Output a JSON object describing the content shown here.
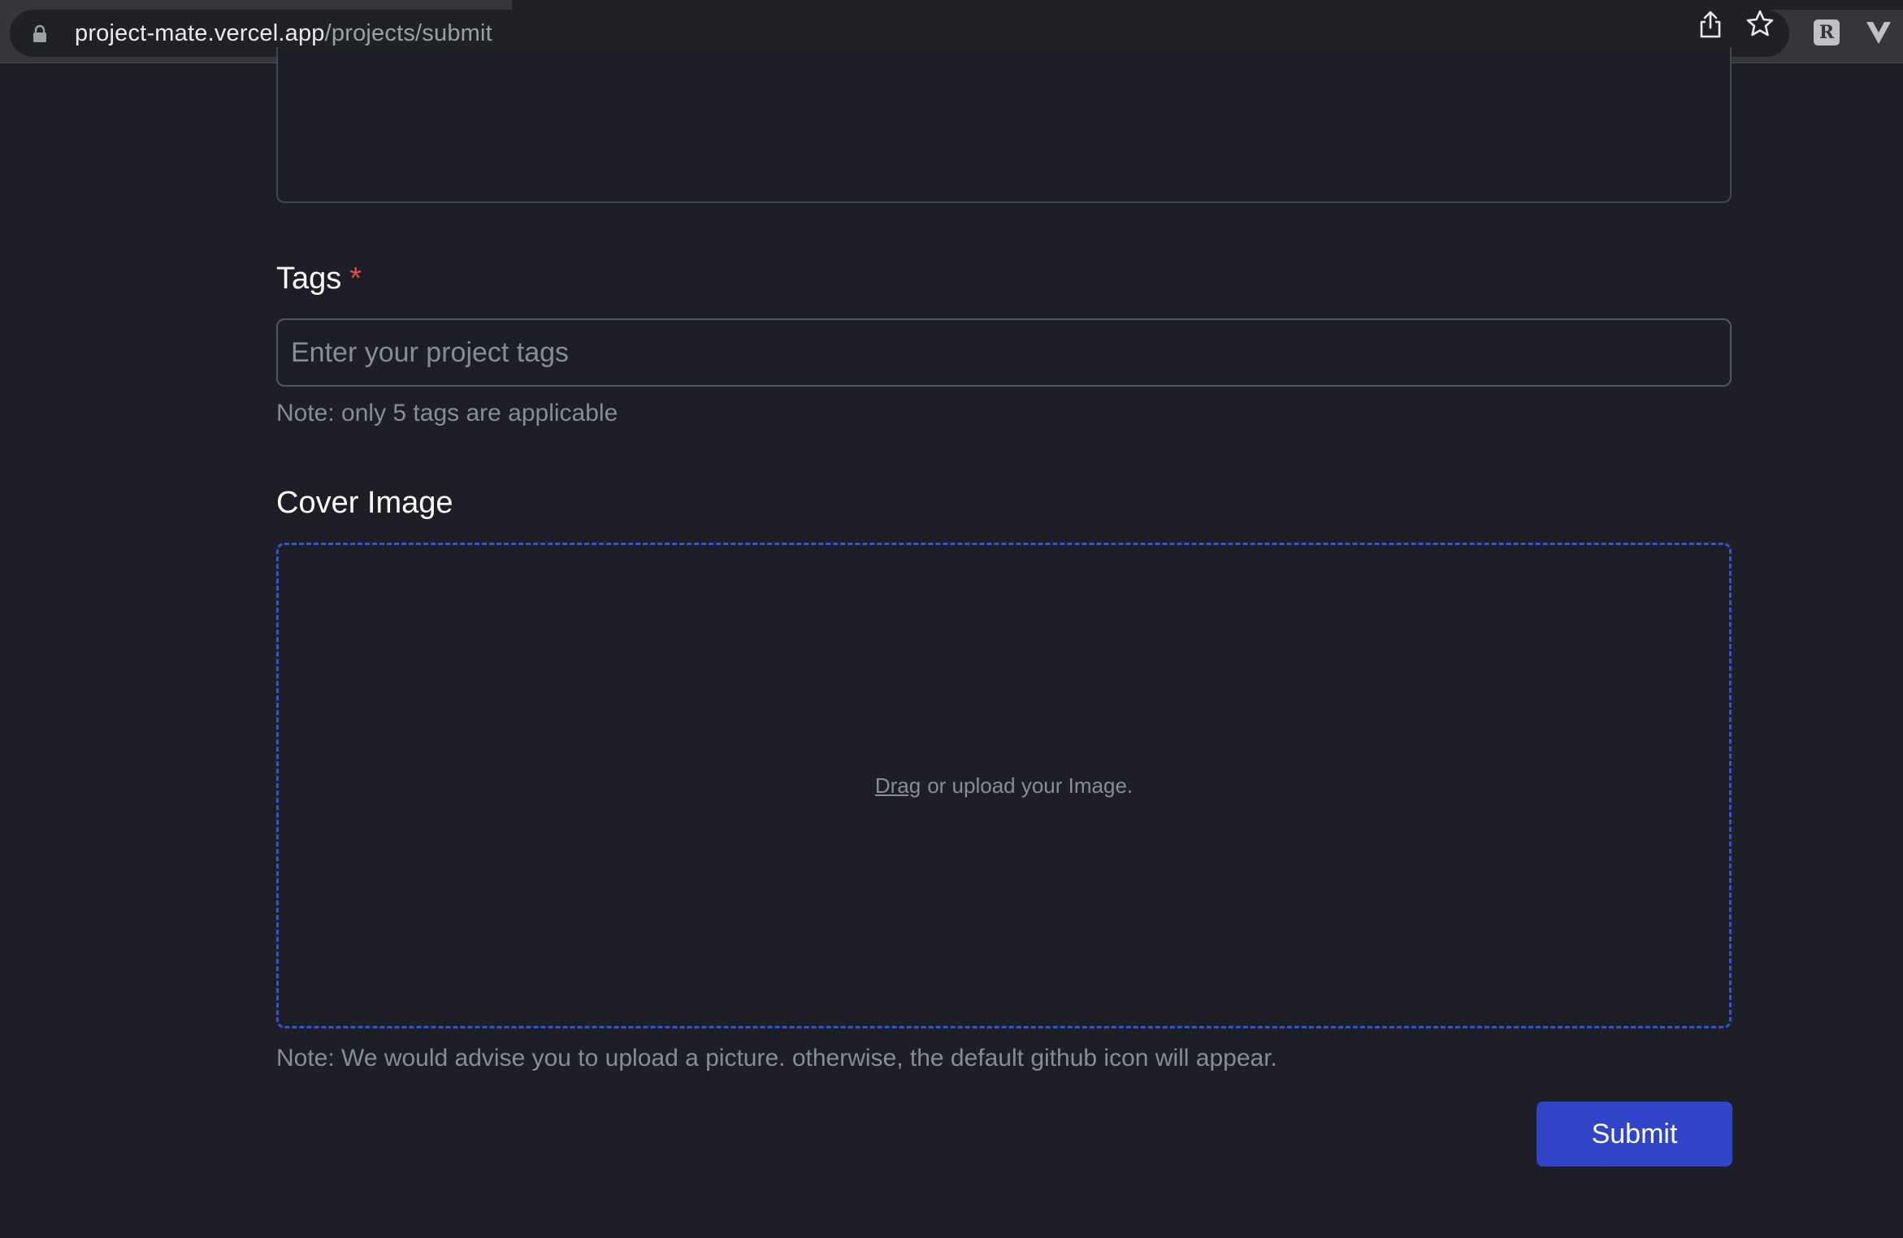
{
  "browser": {
    "url_host": "project-mate.vercel.app",
    "url_path": "/projects/submit",
    "icons": [
      "lock-icon",
      "share-icon",
      "bookmark-star-icon",
      "extension-r-icon",
      "extension-v-icon"
    ]
  },
  "form": {
    "tags": {
      "label": "Tags",
      "required_mark": "*",
      "placeholder": "Enter your project tags",
      "value": "",
      "note": "Note: only 5 tags are applicable"
    },
    "cover_image": {
      "label": "Cover Image",
      "drag_link": "Drag",
      "drop_text": "or upload your Image.",
      "note": "Note: We would advise you to upload a picture. otherwise, the default github icon will appear."
    },
    "submit_label": "Submit"
  },
  "colors": {
    "background": "#1e1f26",
    "accent": "#2f44c6",
    "dropzone_border": "#2f55d4",
    "required": "#e5484d",
    "muted_text": "#8a8c94"
  }
}
